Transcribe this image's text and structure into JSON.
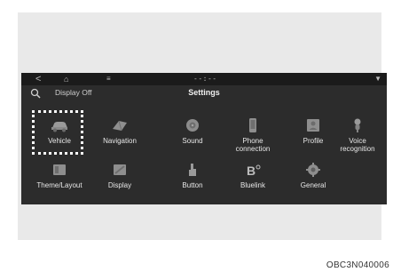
{
  "statusbar": {
    "back": "<",
    "home": "⌂",
    "menu": "≡",
    "clock": "--:--",
    "signal": "▼"
  },
  "header": {
    "search_icon": "search-icon",
    "display_off": "Display Off",
    "title": "Settings"
  },
  "menu": {
    "row1": [
      {
        "label": "Vehicle",
        "icon": "car-icon"
      },
      {
        "label": "Navigation",
        "icon": "navigation-icon"
      },
      {
        "label": "Sound",
        "icon": "speaker-icon"
      },
      {
        "label": "Phone\nconnection",
        "icon": "phone-icon"
      },
      {
        "label": "Profile",
        "icon": "profile-icon"
      },
      {
        "label": "Voice\nrecognition",
        "icon": "microphone-icon"
      }
    ],
    "row2": [
      {
        "label": "Theme/Layout",
        "icon": "theme-icon"
      },
      {
        "label": "Display",
        "icon": "display-icon"
      },
      {
        "label": "Button",
        "icon": "button-icon"
      },
      {
        "label": "Bluelink",
        "icon": "bluelink-icon"
      },
      {
        "label": "General",
        "icon": "gear-icon"
      }
    ]
  },
  "caption": "OBC3N040006",
  "colors": {
    "screen_bg": "#2c2c2c",
    "statusbar_bg": "#1b1b1b",
    "icon_gray": "#9a9a9a",
    "highlight": "#ffffff"
  }
}
